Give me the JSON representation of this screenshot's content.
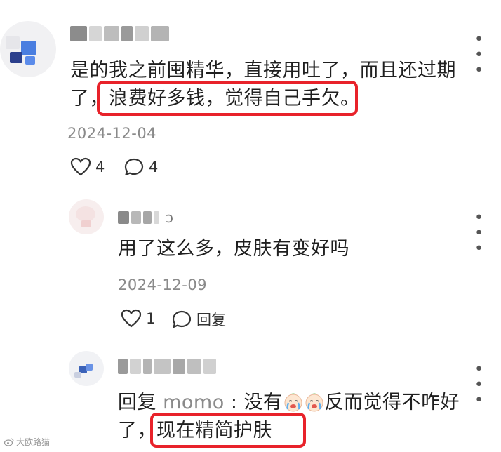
{
  "comment1": {
    "line1": "是的我之前囤精华，直接用吐了，而且还过期",
    "line2_prefix": "了，",
    "line2_highlight": "浪费好多钱，觉得自己手欠。",
    "date": "2024-12-04",
    "likes": "4",
    "replies": "4",
    "more_icon": "more-dots-icon"
  },
  "reply1": {
    "name_suffix": "ɔ",
    "text": "用了这么多，皮肤有变好吗",
    "date": "2024-12-09",
    "likes": "1",
    "reply_label": "回复"
  },
  "reply2": {
    "line1_prefix": "回复 ",
    "mention": "momo",
    "line1_mid": " : 没有",
    "line1_suffix": "反而觉得不咋好",
    "line2_prefix": "了，",
    "line2_highlight": "现在精简护肤"
  },
  "watermark": {
    "text": "大欧路猫"
  },
  "colors": {
    "highlight": "#e8222a",
    "meta_gray": "#8a8a8a"
  }
}
